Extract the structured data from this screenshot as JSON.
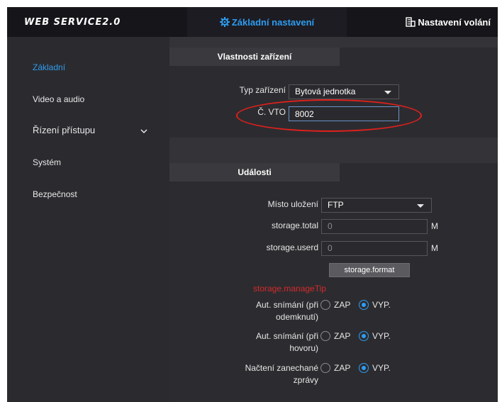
{
  "header": {
    "logo": "WEB SERVICE2.0",
    "tab_basic": "Základní nastavení",
    "tab_calls": "Nastavení volání"
  },
  "sidebar": {
    "items": [
      {
        "label": "Základní"
      },
      {
        "label": "Video a audio"
      },
      {
        "label": "Řízení přístupu"
      },
      {
        "label": "Systém"
      },
      {
        "label": "Bezpečnost"
      }
    ]
  },
  "device": {
    "tab": "Vlastnosti zařízení",
    "type_label": "Typ zařízení",
    "type_value": "Bytová jednotka",
    "vto_label": "Č. VTO",
    "vto_value": "8002"
  },
  "events": {
    "tab": "Události",
    "storage_label": "Místo uložení",
    "storage_value": "FTP",
    "total_label": "storage.total",
    "total_value": "0",
    "used_label": "storage.userd",
    "used_value": "0",
    "unit": "M",
    "format_button": "storage.format",
    "tip": "storage.manageTip",
    "unlock_label_1": "Aut. snímání (při",
    "unlock_label_2": "odemknutí)",
    "call_label_1": "Aut. snímání (při",
    "call_label_2": "hovoru)",
    "msg_label_1": "Načtení zanechané",
    "msg_label_2": "zprávy",
    "on_label": "ZAP",
    "off_label": "VYP."
  },
  "colors": {
    "accent": "#2e9cf0",
    "tip": "#d42a2a",
    "annotation": "#e0201c"
  }
}
